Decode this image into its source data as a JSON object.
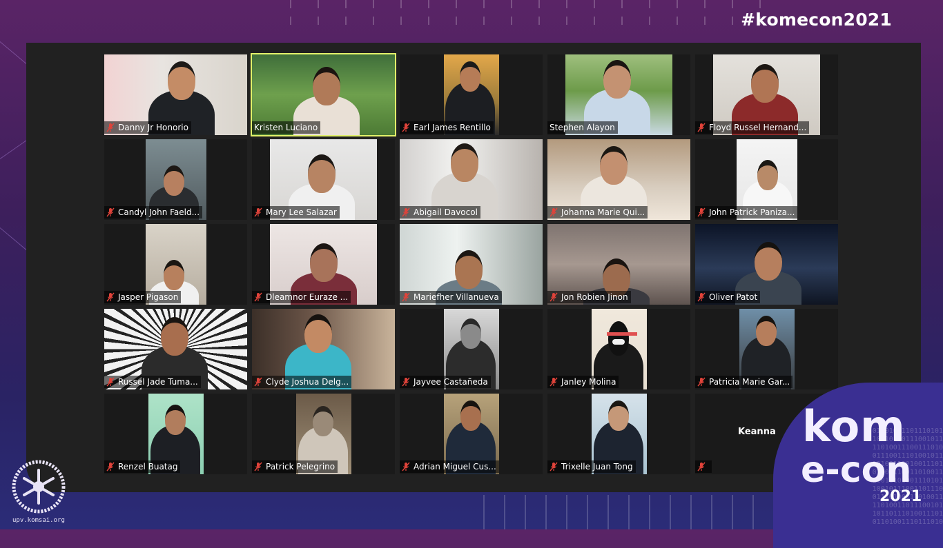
{
  "event": {
    "hashtag": "#komecon2021",
    "logo_line1": "kom",
    "logo_line2": "e-con",
    "logo_year": "2021",
    "org_url": "upv.komsai.org"
  },
  "colors": {
    "active_speaker_border": "#e3f26a",
    "muted_icon": "#e0433a",
    "tile_background": "#1a1a1a",
    "screen_background": "#212121"
  },
  "participants": [
    {
      "name": "Danny Jr Honorio",
      "muted": true,
      "active": false
    },
    {
      "name": "Kristen Luciano",
      "muted": false,
      "active": true
    },
    {
      "name": "Earl James Rentillo",
      "muted": true,
      "active": false
    },
    {
      "name": "Stephen Alayon",
      "muted": false,
      "active": false
    },
    {
      "name": "Floyd Russel Hernand...",
      "muted": true,
      "active": false
    },
    {
      "name": "Candyl John Faeld...",
      "muted": true,
      "active": false
    },
    {
      "name": "Mary Lee Salazar",
      "muted": true,
      "active": false
    },
    {
      "name": "Abigail Davocol",
      "muted": true,
      "active": false
    },
    {
      "name": "Johanna Marie Qui...",
      "muted": true,
      "active": false
    },
    {
      "name": "John Patrick Paniza...",
      "muted": true,
      "active": false
    },
    {
      "name": "Jasper Pigason",
      "muted": true,
      "active": false
    },
    {
      "name": "Dleamnor Euraze ...",
      "muted": true,
      "active": false
    },
    {
      "name": "Mariefher Villanueva",
      "muted": true,
      "active": false
    },
    {
      "name": "Jon Robien Jinon",
      "muted": true,
      "active": false
    },
    {
      "name": "Oliver Patot",
      "muted": true,
      "active": false
    },
    {
      "name": "Russel Jade Tuma...",
      "muted": true,
      "active": false
    },
    {
      "name": "Clyde Joshua Delg...",
      "muted": true,
      "active": false
    },
    {
      "name": "Jayvee Castañeda",
      "muted": true,
      "active": false
    },
    {
      "name": "Janley Molina",
      "muted": true,
      "active": false
    },
    {
      "name": "Patricia Marie Gar...",
      "muted": true,
      "active": false
    },
    {
      "name": "Renzel Buatag",
      "muted": true,
      "active": false
    },
    {
      "name": "Patrick Pelegrino",
      "muted": true,
      "active": false
    },
    {
      "name": "Adrian Miguel Cus...",
      "muted": true,
      "active": false
    },
    {
      "name": "Trixelle Juan Tong",
      "muted": true,
      "active": false
    },
    {
      "name": "",
      "label": "Keanna",
      "muted": true,
      "active": false
    }
  ]
}
